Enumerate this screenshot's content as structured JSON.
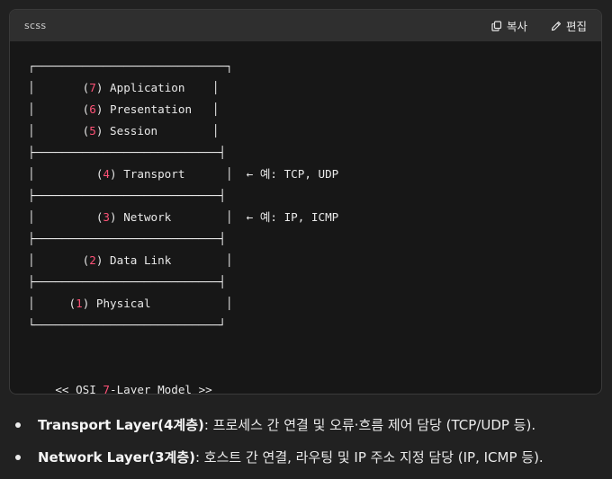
{
  "code_block": {
    "language": "scss",
    "copy_label": "복사",
    "edit_label": "편집",
    "copy_icon": "copy-icon",
    "edit_icon": "pencil-icon",
    "lines": [
      [
        {
          "t": "┌────────────────────────────┐"
        }
      ],
      [
        {
          "t": "│       "
        },
        {
          "t": "(",
          "c": "p"
        },
        {
          "t": "7",
          "c": "n"
        },
        {
          "t": ")",
          "c": "p"
        },
        {
          "t": " Application    │"
        }
      ],
      [
        {
          "t": "│       "
        },
        {
          "t": "(",
          "c": "p"
        },
        {
          "t": "6",
          "c": "n"
        },
        {
          "t": ")",
          "c": "p"
        },
        {
          "t": " Presentation   │"
        }
      ],
      [
        {
          "t": "│       "
        },
        {
          "t": "(",
          "c": "p"
        },
        {
          "t": "5",
          "c": "n"
        },
        {
          "t": ")",
          "c": "p"
        },
        {
          "t": " Session        │"
        }
      ],
      [
        {
          "t": "├───────────────────────────┤"
        }
      ],
      [
        {
          "t": "│         "
        },
        {
          "t": "(",
          "c": "p"
        },
        {
          "t": "4",
          "c": "n"
        },
        {
          "t": ")",
          "c": "p"
        },
        {
          "t": " Transport      │  ← 예: TCP, UDP"
        }
      ],
      [
        {
          "t": "├───────────────────────────┤"
        }
      ],
      [
        {
          "t": "│         "
        },
        {
          "t": "(",
          "c": "p"
        },
        {
          "t": "3",
          "c": "n"
        },
        {
          "t": ")",
          "c": "p"
        },
        {
          "t": " Network        │  ← 예: IP, ICMP"
        }
      ],
      [
        {
          "t": "├───────────────────────────┤"
        }
      ],
      [
        {
          "t": "│       "
        },
        {
          "t": "(",
          "c": "p"
        },
        {
          "t": "2",
          "c": "n"
        },
        {
          "t": ")",
          "c": "p"
        },
        {
          "t": " Data Link        │"
        }
      ],
      [
        {
          "t": "├───────────────────────────┤"
        }
      ],
      [
        {
          "t": "│     "
        },
        {
          "t": "(",
          "c": "p"
        },
        {
          "t": "1",
          "c": "n"
        },
        {
          "t": ")",
          "c": "p"
        },
        {
          "t": " Physical           │"
        }
      ],
      [
        {
          "t": "└───────────────────────────┘"
        }
      ],
      [
        {
          "t": ""
        }
      ],
      [
        {
          "t": ""
        }
      ],
      [
        {
          "t": "    << OSI "
        },
        {
          "t": "7",
          "c": "n"
        },
        {
          "t": "-Layer Model >>"
        }
      ]
    ]
  },
  "bullets": [
    {
      "bold": "Transport Layer(4계층)",
      "text": ": 프로세스 간 연결 및 오류·흐름 제어 담당 (TCP/UDP 등)."
    },
    {
      "bold": "Network Layer(3계층)",
      "text": ": 호스트 간 연결, 라우팅 및 IP 주소 지정 담당 (IP, ICMP 등)."
    }
  ],
  "colors": {
    "background": "#212121",
    "code_background": "#171717",
    "header_background": "#2f2f2f",
    "number_highlight": "#ff5277"
  }
}
